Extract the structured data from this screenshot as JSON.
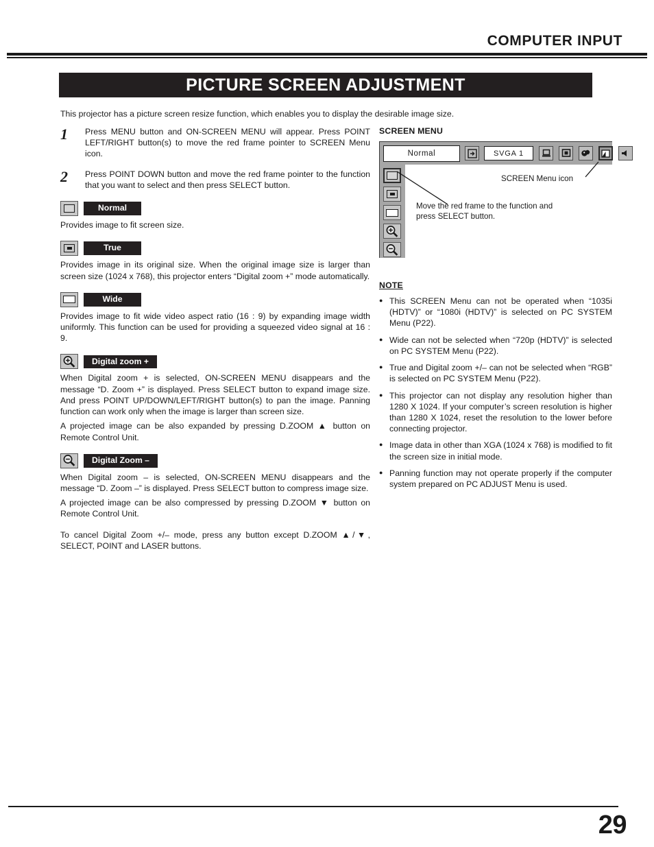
{
  "header": {
    "title": "COMPUTER INPUT"
  },
  "banner": {
    "title": "PICTURE SCREEN ADJUSTMENT"
  },
  "intro": "This projector has a picture screen resize function, which enables you to display the desirable image size.",
  "steps": [
    {
      "num": "1",
      "text": "Press MENU button and ON-SCREEN MENU will appear.  Press POINT LEFT/RIGHT button(s) to move the red frame pointer to SCREEN Menu icon."
    },
    {
      "num": "2",
      "text": "Press POINT DOWN button and move the red frame pointer to the function that you want to select and then press SELECT button."
    }
  ],
  "functions": [
    {
      "icon": "normal-screen-icon",
      "label": "Normal",
      "text": "Provides image to fit screen size."
    },
    {
      "icon": "true-screen-icon",
      "label": "True",
      "text": "Provides image in its original size.  When the original image size is larger than screen size (1024 x 768), this projector enters “Digital zoom +” mode automatically."
    },
    {
      "icon": "wide-screen-icon",
      "label": "Wide",
      "text": "Provides image to fit wide video aspect ratio (16 : 9) by expanding image width uniformly.  This function can be used for providing a squeezed video signal at 16 : 9."
    },
    {
      "icon": "zoom-in-icon",
      "label": "Digital zoom +",
      "text": "When Digital zoom + is selected, ON-SCREEN MENU disappears and the message “D. Zoom +” is displayed.  Press SELECT button to expand image size.  And press POINT UP/DOWN/LEFT/RIGHT button(s) to pan the image.  Panning function can work only when the image is larger than screen size.",
      "text2": "A projected image can be also expanded by pressing D.ZOOM ▲ button on Remote Control Unit."
    },
    {
      "icon": "zoom-out-icon",
      "label": "Digital Zoom –",
      "text": "When Digital zoom – is selected, ON-SCREEN MENU disappears and the message “D. Zoom –” is displayed.  Press SELECT button to compress image size.",
      "text2": "A projected image can be also compressed by pressing D.ZOOM ▼ button on Remote Control Unit."
    }
  ],
  "tail": "To cancel Digital Zoom +/– mode, press any button except D.ZOOM ▲/▼, SELECT, POINT and LASER buttons.",
  "screen_menu": {
    "title": "SCREEN MENU",
    "selected_value": "Normal",
    "system_value": "SVGA 1",
    "bar_icons": [
      "input-source-icon",
      "pc-system-icon",
      "image-select-icon",
      "image-adjust-icon",
      "screen-icon",
      "sound-icon"
    ],
    "side_icons": [
      "normal-screen-icon",
      "true-screen-icon",
      "wide-screen-icon",
      "zoom-in-icon",
      "zoom-out-icon"
    ],
    "callout_top": "SCREEN Menu icon",
    "callout_mid_line1": "Move the red frame to the function and",
    "callout_mid_line2": "press SELECT button."
  },
  "note": {
    "title": "NOTE",
    "items": [
      "This SCREEN Menu can not be operated when “1035i (HDTV)” or “1080i (HDTV)” is selected on PC SYSTEM Menu  (P22).",
      "Wide can not be selected when “720p (HDTV)” is selected on PC SYSTEM Menu  (P22).",
      "True and Digital zoom +/– can not be selected when “RGB” is selected on PC SYSTEM Menu (P22).",
      "This projector can not display any resolution higher than 1280 X 1024.  If your computer’s screen resolution is higher than 1280 X 1024, reset the resolution to the lower before connecting projector.",
      "Image data in other than XGA (1024 x 768) is modified to fit the screen size in initial mode.",
      "Panning function may not operate properly if the computer system prepared on PC ADJUST Menu is used."
    ]
  },
  "footer": {
    "page_number": "29"
  }
}
